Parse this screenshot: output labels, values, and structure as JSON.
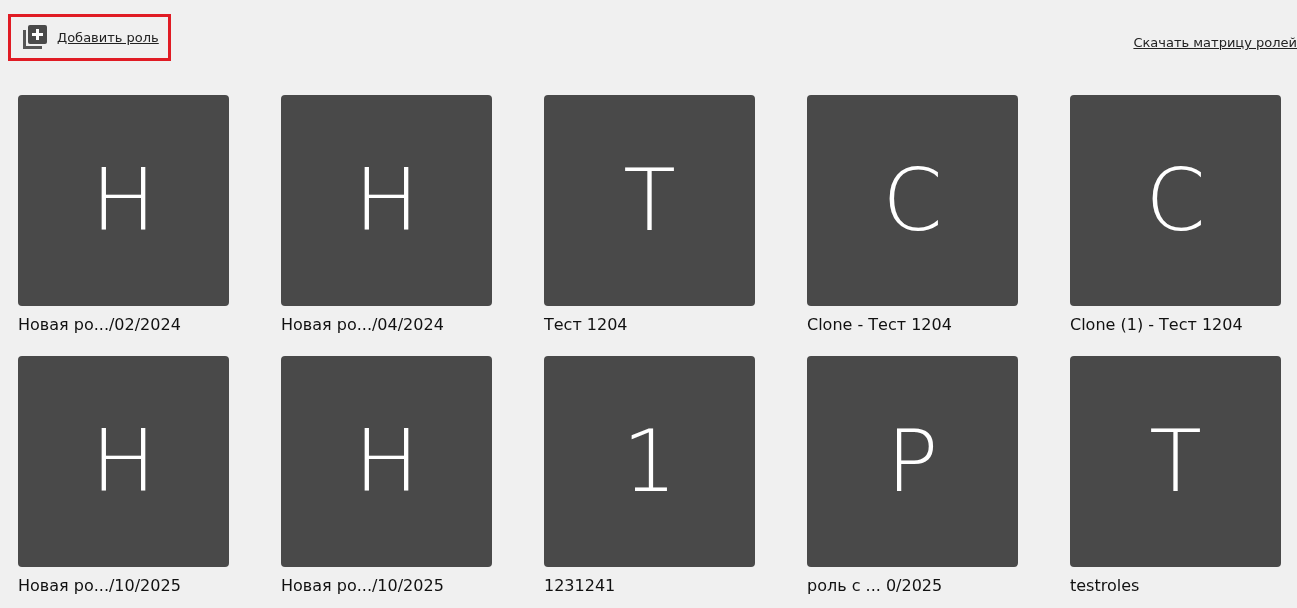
{
  "toolbar": {
    "add_role": {
      "label": "Добавить роль",
      "highlighted": true
    },
    "download_link": "Скачать матрицу ролей"
  },
  "roles": [
    {
      "letter": "Н",
      "name": "Новая ро.../02/2024"
    },
    {
      "letter": "Н",
      "name": "Новая ро.../04/2024"
    },
    {
      "letter": "Т",
      "name": "Тест 1204"
    },
    {
      "letter": "C",
      "name": "Clone - Тест 1204"
    },
    {
      "letter": "C",
      "name": "Clone (1) - Тест 1204"
    },
    {
      "letter": "Н",
      "name": "Новая ро.../10/2025"
    },
    {
      "letter": "Н",
      "name": "Новая ро.../10/2025"
    },
    {
      "letter": "1",
      "name": "1231241"
    },
    {
      "letter": "Р",
      "name": "роль с ... 0/2025"
    },
    {
      "letter": "T",
      "name": "testroles"
    }
  ]
}
